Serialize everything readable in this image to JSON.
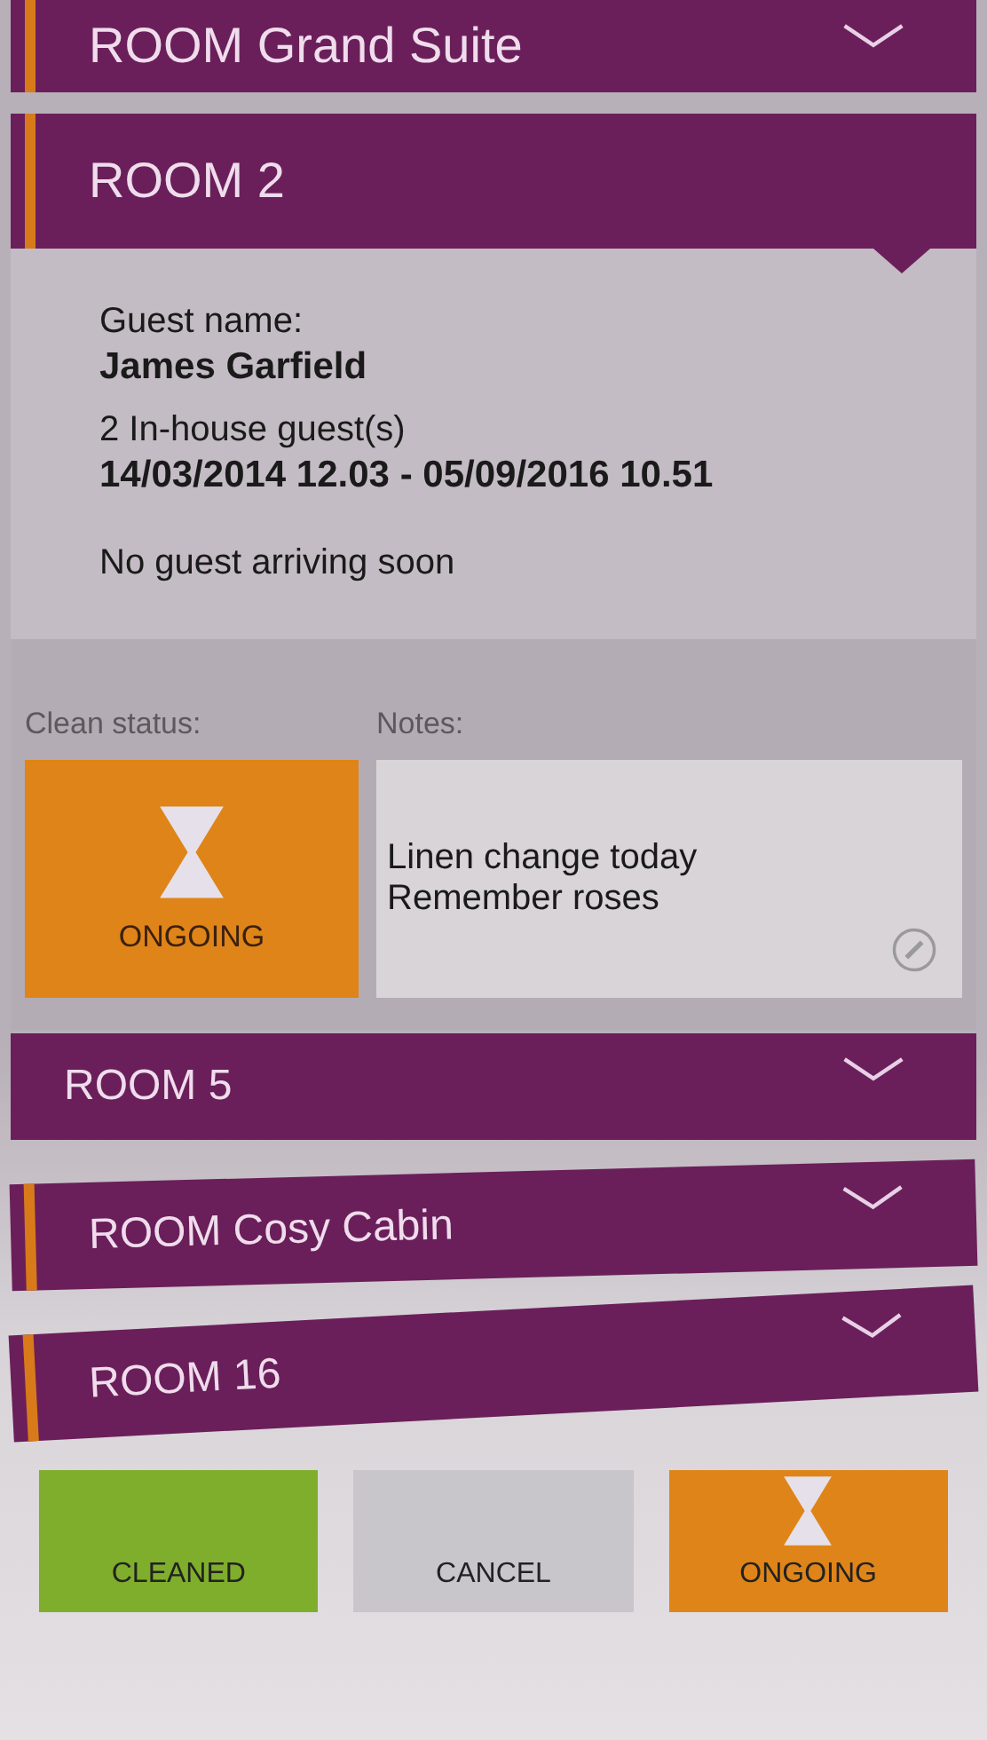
{
  "top_room": {
    "name": "ROOM Grand Suite",
    "flagged": true,
    "expanded": false
  },
  "open_room": {
    "name": "ROOM 2",
    "flagged": true,
    "expanded": true
  },
  "details": {
    "guest_label": "Guest name:",
    "guest_name": "James Garfield",
    "guests": "2 In-house guest(s)",
    "stay": "14/03/2014 12.03 - 05/09/2016 10.51",
    "arrival": "No guest arriving soon"
  },
  "clean_status": {
    "label": "Clean status:",
    "kind": "ongoing",
    "text": "ONGOING"
  },
  "notes": {
    "label": "Notes:",
    "lines": [
      "Linen change today",
      "Remember roses"
    ]
  },
  "rooms": [
    {
      "name": "ROOM 5",
      "flagged": false,
      "expanded": false
    },
    {
      "name": "ROOM Cosy Cabin",
      "flagged": true,
      "expanded": false
    },
    {
      "name": "ROOM 16",
      "flagged": true,
      "expanded": false
    }
  ],
  "actions": [
    {
      "label": "CLEANED",
      "kind": "cleaned"
    },
    {
      "label": "CANCEL",
      "kind": "cancel"
    },
    {
      "label": "ONGOING",
      "kind": "ongoing"
    }
  ]
}
